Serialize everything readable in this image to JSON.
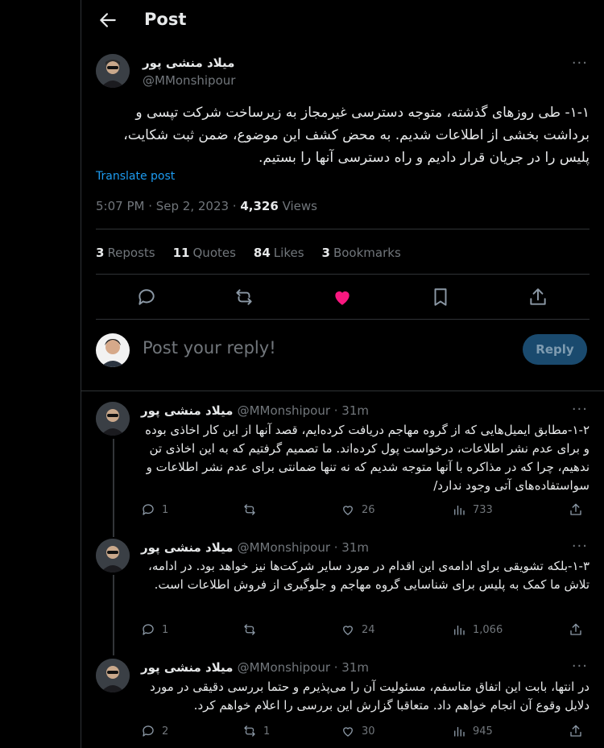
{
  "header": {
    "title": "Post"
  },
  "main_post": {
    "name": "میلاد منشی پور",
    "handle": "@MMonshipour",
    "text": "۱-۱- طی روزهای گذشته، متوجه دسترسی غیرمجاز به زیرساخت شرکت تپسی و برداشت بخشی از اطلاعات شدیم. به محض کشف این موضوع، ضمن ثبت شکایت، پلیس را در جریان قرار دادیم و راه دسترسی آنها را بستیم.",
    "translate": "Translate post",
    "time": "5:07 PM · Sep 2, 2023 · ",
    "views_count": "4,326",
    "views_label": " Views",
    "stats": {
      "reposts_count": "3",
      "reposts_label": "Reposts",
      "quotes_count": "11",
      "quotes_label": "Quotes",
      "likes_count": "84",
      "likes_label": "Likes",
      "bookmarks_count": "3",
      "bookmarks_label": "Bookmarks"
    },
    "liked_color": "#f91880"
  },
  "reply_box": {
    "placeholder": "Post your reply!",
    "button": "Reply"
  },
  "replies": [
    {
      "name": "میلاد منشی پور",
      "handle_time": "@MMonshipour · 31m",
      "text": "۱-۲-مطابق ایمیل‌هایی که از گروه مهاجم دریافت کرده‌ایم، قصد آنها از این کار اخاذی بوده و برای عدم نشر اطلاعات، درخواست پول کرده‌اند. ما تصمیم گرفتیم که به این اخاذی تن ندهیم، چرا که در مذاکره با آنها متوجه شدیم که نه تنها ضمانتی برای عدم نشر اطلاعات و سواستفاده‌های آتی وجود ندارد/",
      "replies": "1",
      "reposts": "",
      "likes": "26",
      "views": "733"
    },
    {
      "name": "میلاد منشی پور",
      "handle_time": "@MMonshipour · 31m",
      "text": "۱-۳-بلکه تشویقی برای ادامه‌ی این اقدام در مورد سایر شرکت‌ها نیز خواهد بود. در ادامه، تلاش ما کمک به پلیس برای شناسایی گروه مهاجم و جلوگیری از فروش اطلاعات است.",
      "replies": "1",
      "reposts": "",
      "likes": "24",
      "views": "1,066"
    },
    {
      "name": "میلاد منشی پور",
      "handle_time": "@MMonshipour · 31m",
      "text": "در انتها، بابت این اتفاق متاسفم، مسئولیت آن را می‌پذیرم و حتما بررسی دقیقی در مورد دلایل وقوع آن انجام خواهم داد. متعاقبا گزارش این بررسی را اعلام خواهم کرد.",
      "replies": "2",
      "reposts": "1",
      "likes": "30",
      "views": "945"
    }
  ]
}
